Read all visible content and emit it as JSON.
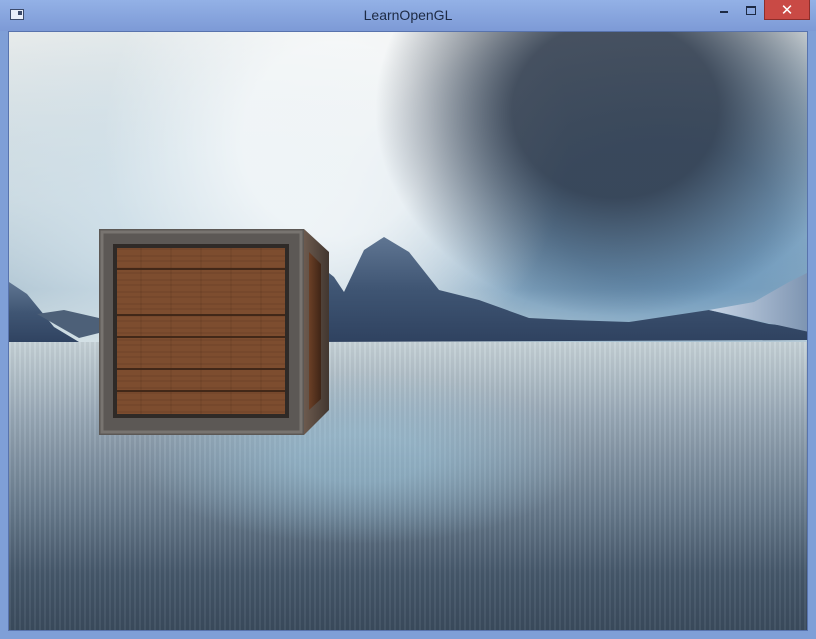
{
  "window": {
    "title": "LearnOpenGL",
    "controls": {
      "minimize_icon": "minimize-icon",
      "maximize_icon": "maximize-icon",
      "close_icon": "close-icon",
      "close_glyph": "✕"
    }
  },
  "scene": {
    "objects": [
      "skybox",
      "wooden-crate"
    ],
    "colors": {
      "crate_wood": "#7a4a2a",
      "crate_metal": "#5d5a56",
      "sky": "#c6d4db",
      "water": "#6c7f91"
    }
  }
}
